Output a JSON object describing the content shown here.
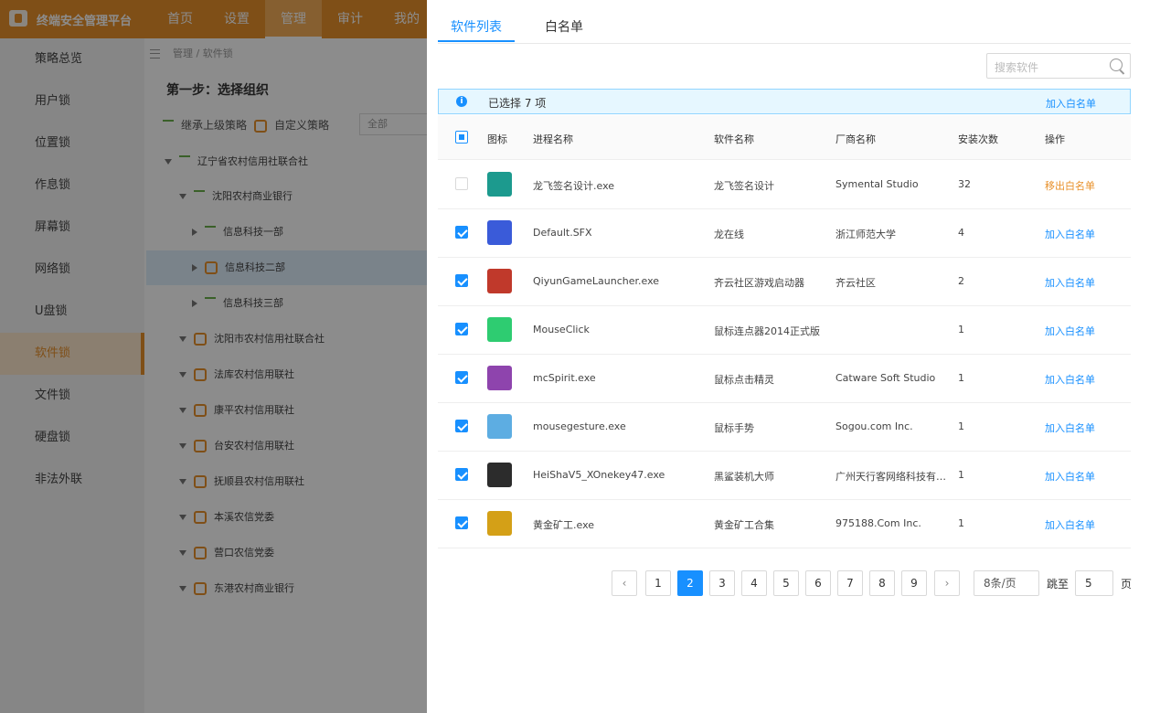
{
  "app": {
    "title": "终端安全管理平台"
  },
  "nav": [
    "首页",
    "设置",
    "管理",
    "审计",
    "我的"
  ],
  "sidebar": [
    "策略总览",
    "用户锁",
    "位置锁",
    "作息锁",
    "屏幕锁",
    "网络锁",
    "U盘锁",
    "软件锁",
    "文件锁",
    "硬盘锁",
    "非法外联"
  ],
  "breadcrumb": "管理 / 软件锁",
  "step_title": "第一步：选择组织",
  "toolbar": {
    "inherit": "继承上级策略",
    "custom": "自定义策略",
    "scope_value": "全部"
  },
  "tree": [
    "辽宁省农村信用社联合社",
    "沈阳农村商业银行",
    "信息科技一部",
    "信息科技二部",
    "信息科技三部",
    "沈阳市农村信用社联合社",
    "法库农村信用联社",
    "康平农村信用联社",
    "台安农村信用联社",
    "抚顺县农村信用联社",
    "本溪农信党委",
    "营口农信党委",
    "东港农村商业银行"
  ],
  "drawer": {
    "tabs": [
      "软件列表",
      "白名单"
    ],
    "search_placeholder": "搜索软件",
    "alert": {
      "text": "已选择 7 项",
      "action": "加入白名单"
    },
    "columns": [
      "图标",
      "进程名称",
      "软件名称",
      "厂商名称",
      "安装次数",
      "操作"
    ],
    "rows": [
      {
        "process": "龙飞签名设计.exe",
        "software": "龙飞签名设计",
        "vendor": "Symental Studio",
        "installs": "32",
        "action": "移出白名单",
        "checked": false,
        "icon_color": "#1c9a8e"
      },
      {
        "process": "Default.SFX",
        "software": "龙在线",
        "vendor": "浙江师范大学",
        "installs": "4",
        "action": "加入白名单",
        "checked": true,
        "icon_color": "#3a5bd9"
      },
      {
        "process": "QiyunGameLauncher.exe",
        "software": "齐云社区游戏启动器",
        "vendor": "齐云社区",
        "installs": "2",
        "action": "加入白名单",
        "checked": true,
        "icon_color": "#c0392b"
      },
      {
        "process": "MouseClick",
        "software": "鼠标连点器2014正式版",
        "vendor": "",
        "installs": "1",
        "action": "加入白名单",
        "checked": true,
        "icon_color": "#2ecc71"
      },
      {
        "process": "mcSpirit.exe",
        "software": "鼠标点击精灵",
        "vendor": "Catware Soft Studio",
        "installs": "1",
        "action": "加入白名单",
        "checked": true,
        "icon_color": "#8e44ad"
      },
      {
        "process": "mousegesture.exe",
        "software": "鼠标手势",
        "vendor": "Sogou.com Inc.",
        "installs": "1",
        "action": "加入白名单",
        "checked": true,
        "icon_color": "#5dade2"
      },
      {
        "process": "HeiShaV5_XOnekey47.exe",
        "software": "黑鲨装机大师",
        "vendor": "广州天行客网络科技有…",
        "installs": "1",
        "action": "加入白名单",
        "checked": true,
        "icon_color": "#2c2c2c"
      },
      {
        "process": "黄金矿工.exe",
        "software": "黄金矿工合集",
        "vendor": "975188.Com Inc.",
        "installs": "1",
        "action": "加入白名单",
        "checked": true,
        "icon_color": "#d4a017"
      }
    ],
    "pagination": {
      "pages": [
        "1",
        "2",
        "3",
        "4",
        "5",
        "6",
        "7",
        "8",
        "9"
      ],
      "current": "2",
      "page_size": "8条/页",
      "jump_label": "跳至",
      "jump_value": "5",
      "jump_suffix": "页"
    }
  }
}
